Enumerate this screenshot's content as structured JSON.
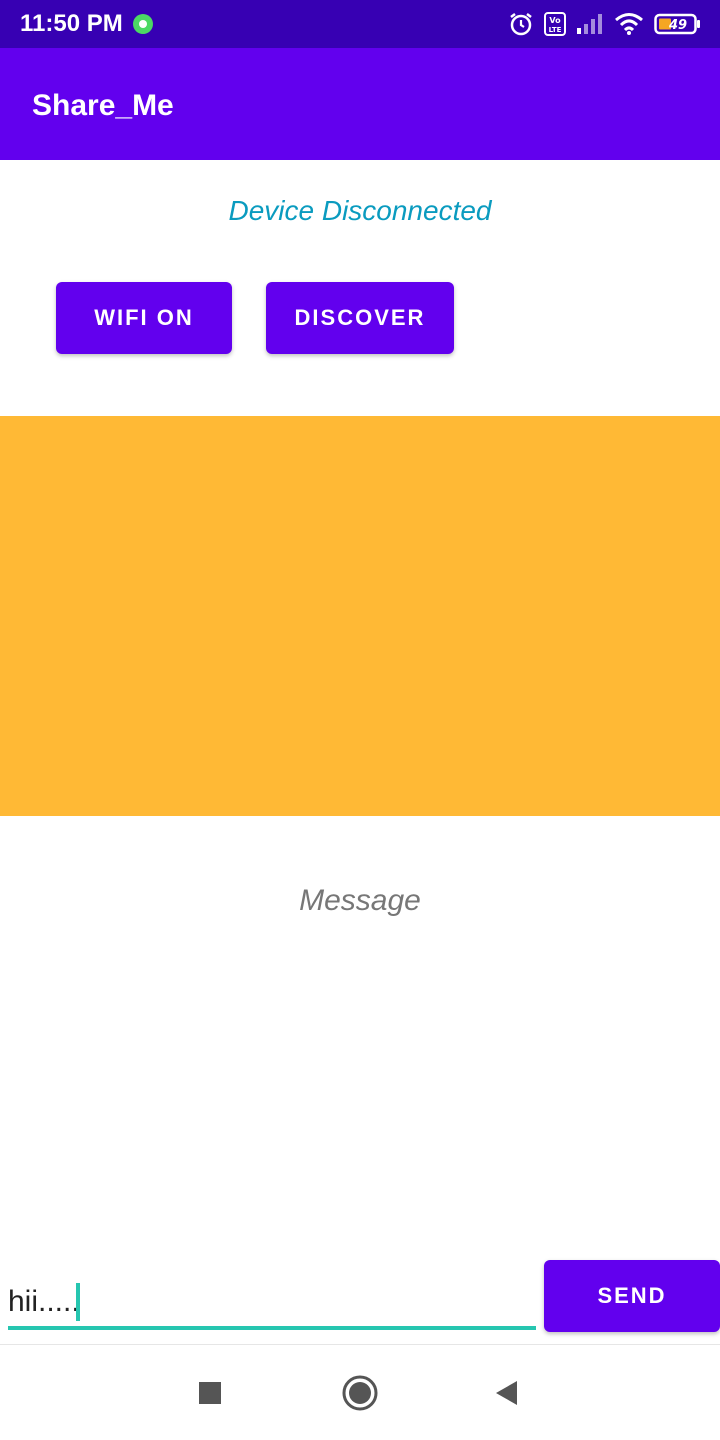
{
  "status_bar": {
    "time": "11:50 PM",
    "battery": "49"
  },
  "app_bar": {
    "title": "Share_Me"
  },
  "connection": {
    "status_text": "Device Disconnected"
  },
  "buttons": {
    "wifi_label": "WIFI ON",
    "discover_label": "DISCOVER",
    "send_label": "SEND"
  },
  "message": {
    "display_text": "Message"
  },
  "input": {
    "value": "hii....."
  },
  "colors": {
    "status_bar": "#3700b3",
    "primary": "#6200ee",
    "status_text": "#0a9bbf",
    "peer_list_bg": "#ffb935",
    "input_accent": "#26c6b0"
  },
  "nav_icons": [
    "recents-icon",
    "home-icon",
    "back-icon"
  ]
}
